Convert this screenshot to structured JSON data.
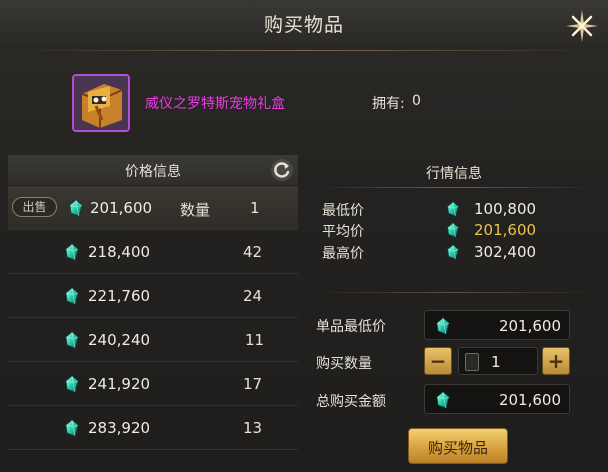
{
  "header": {
    "title": "购买物品"
  },
  "item": {
    "name": "威仪之罗特斯宠物礼盒",
    "owned_label": "拥有:",
    "owned_value": "0"
  },
  "price_list": {
    "title": "价格信息",
    "sell_tag": "出售",
    "qty_label": "数量",
    "rows": [
      {
        "price": "201,600",
        "qty": "1"
      },
      {
        "price": "218,400",
        "qty": "42"
      },
      {
        "price": "221,760",
        "qty": "24"
      },
      {
        "price": "240,240",
        "qty": "11"
      },
      {
        "price": "241,920",
        "qty": "17"
      },
      {
        "price": "283,920",
        "qty": "13"
      }
    ]
  },
  "market": {
    "title": "行情信息",
    "min_label": "最低价",
    "min_value": "100,800",
    "avg_label": "平均价",
    "avg_value": "201,600",
    "max_label": "最高价",
    "max_value": "302,400"
  },
  "purchase": {
    "unit_min_label": "单品最低价",
    "unit_min_value": "201,600",
    "qty_label": "购买数量",
    "qty_value": "1",
    "minus": "−",
    "plus": "+",
    "total_label": "总购买金额",
    "total_value": "201,600",
    "buy_label": "购买物品"
  },
  "icons": {
    "currency": "crystal-gem-icon",
    "refresh": "refresh-icon",
    "close": "close-icon",
    "item": "pet-gift-box-icon"
  },
  "colors": {
    "item_name": "#e43ee0",
    "gold_value": "#f1c24b",
    "button": "#d9a23e",
    "item_border": "#b14fd6"
  }
}
